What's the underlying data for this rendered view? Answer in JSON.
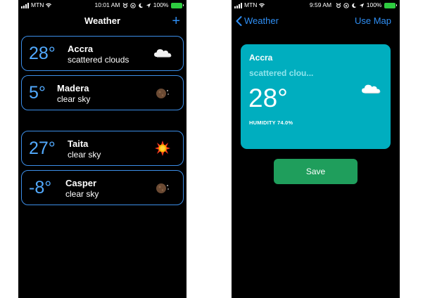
{
  "screens": {
    "list": {
      "status": {
        "carrier": "MTN",
        "time": "10:01 AM",
        "battery": "100%"
      },
      "title": "Weather",
      "add_label": "+",
      "cities": [
        {
          "temp": "28°",
          "name": "Accra",
          "desc": "scattered clouds",
          "icon": "cloud-icon"
        },
        {
          "temp": "5°",
          "name": "Madera",
          "desc": "clear sky",
          "icon": "moon-icon"
        },
        {
          "temp": "27°",
          "name": "Taita",
          "desc": "clear sky",
          "icon": "sun-icon"
        },
        {
          "temp": "-8°",
          "name": "Casper",
          "desc": "clear sky",
          "icon": "moon-icon"
        }
      ]
    },
    "detail": {
      "status": {
        "carrier": "MTN",
        "time": "9:59 AM",
        "battery": "100%"
      },
      "back_label": "Weather",
      "use_map_label": "Use Map",
      "card": {
        "city": "Accra",
        "desc": "scattered clou...",
        "temp": "28°",
        "humidity": "HUMIDITY 74.0%",
        "icon": "cloud-icon"
      },
      "save_label": "Save"
    }
  },
  "colors": {
    "accent_blue": "#2f8ff5",
    "temp_blue": "#52aaff",
    "card_teal": "#00aebf",
    "save_green": "#1f9e5c",
    "battery_green": "#2ecc40"
  }
}
